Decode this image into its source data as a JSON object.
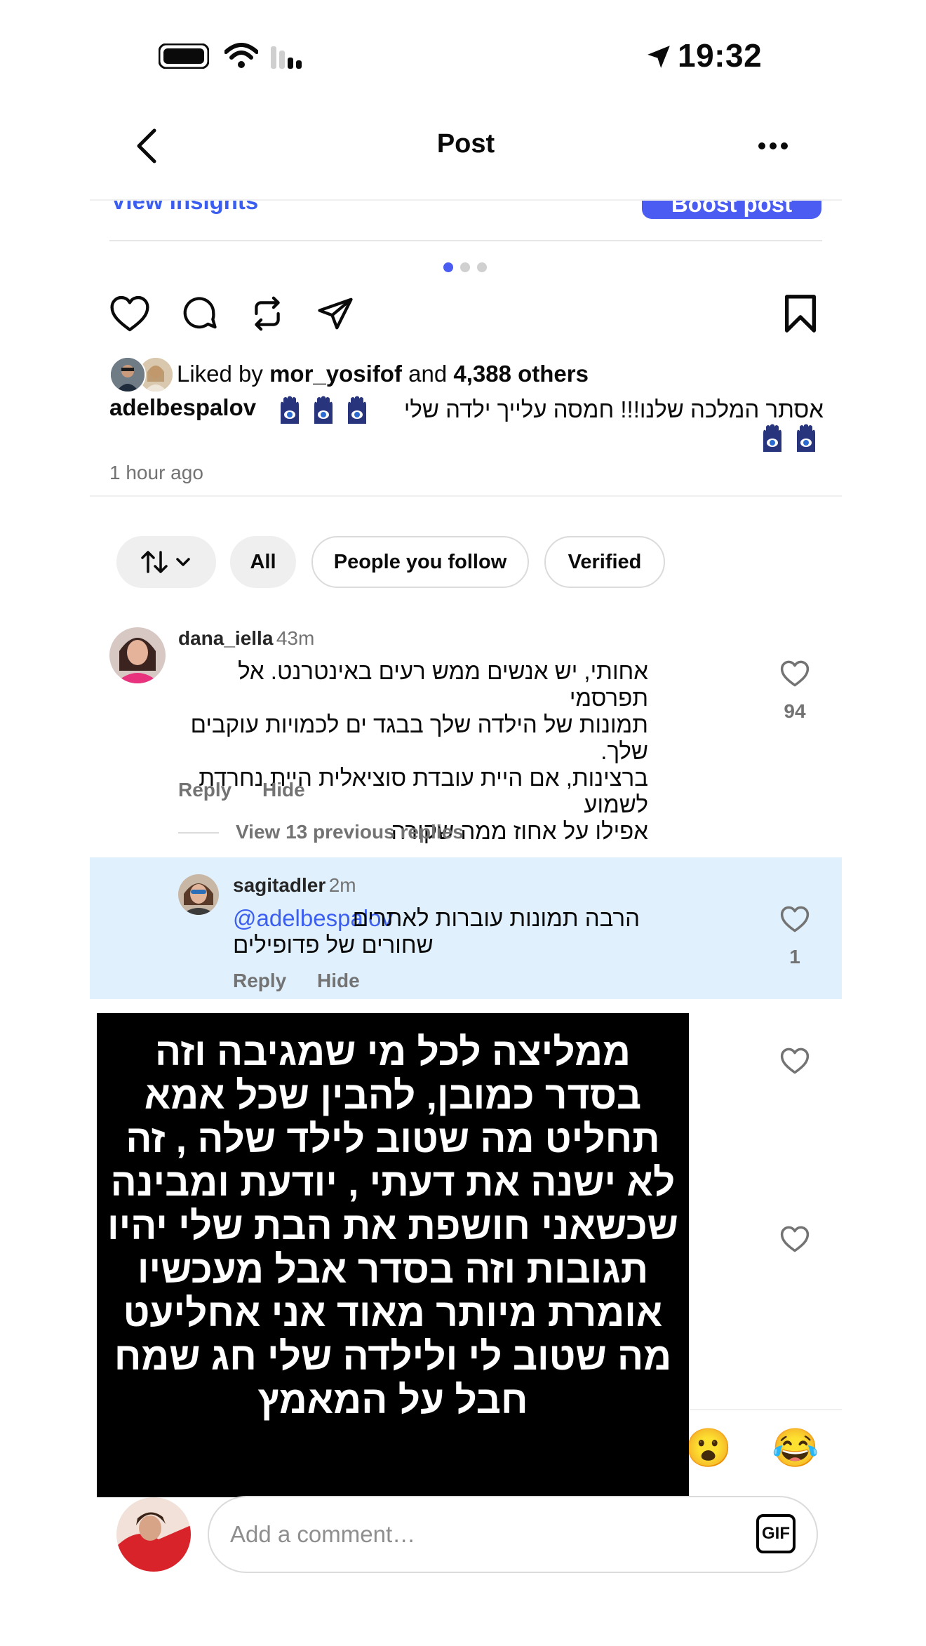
{
  "status_bar": {
    "time": "19:32"
  },
  "header": {
    "title": "Post"
  },
  "post_actions_top": {
    "insights_label": "View insights",
    "boost_label": "Boost post"
  },
  "carousel": {
    "current": 1,
    "total": 3
  },
  "likes": {
    "prefix": "Liked by",
    "user": "mor_yosifof",
    "connector": "and",
    "others": "4,388 others"
  },
  "caption": {
    "username": "adelbespalov",
    "text": "אסתר המלכה שלנו!!! חמסה עלייך ילדה שלי"
  },
  "time_ago": "1 hour ago",
  "filters": {
    "all": "All",
    "following": "People you follow",
    "verified": "Verified"
  },
  "comments": [
    {
      "username": "dana_iella",
      "time": "43m",
      "lines": [
        "אחותי, יש אנשים ממש רעים באינטרנט. אל תפרסמי",
        "תמונות של הילדה שלך בבגד ים לכמויות עוקבים שלך.",
        "ברצינות, אם היית עובדת סוציאלית היית נחרדת לשמוע",
        "אפילו על אחוז ממה שקורה"
      ],
      "likes": "94",
      "reply_label": "Reply",
      "hide_label": "Hide",
      "view_replies": "View 13 previous replies"
    },
    {
      "username": "sagitadler",
      "time": "2m",
      "mention": "@adelbespalov",
      "line1": "הרבה תמונות עוברות לאתרים",
      "line2": "שחורים של פדופילים",
      "likes": "1",
      "reply_label": "Reply",
      "hide_label": "Hide"
    }
  ],
  "overlay_lines": [
    "ממליצה לכל מי שמגיבה וזה",
    "בסדר כמובן, להבין שכל אמא",
    "תחליט מה שטוב לילד שלה , זה",
    "לא ישנה את דעתי , יודעת ומבינה",
    "שכשאני חושפת את הבת שלי יהיו",
    "תגובות וזה בסדר אבל מעכשיו",
    "אומרת מיותר מאוד אני אחליעט",
    "מה שטוב לי ולילדה שלי חג שמח",
    "חבל על המאמץ"
  ],
  "reactions": [
    "😮",
    "😂"
  ],
  "composer": {
    "placeholder": "Add a comment…",
    "gif_label": "GIF"
  },
  "colors": {
    "accent": "#3b5ef0",
    "boost": "#4a5cf1",
    "highlight": "#e0f1fd",
    "muted": "#737373"
  }
}
